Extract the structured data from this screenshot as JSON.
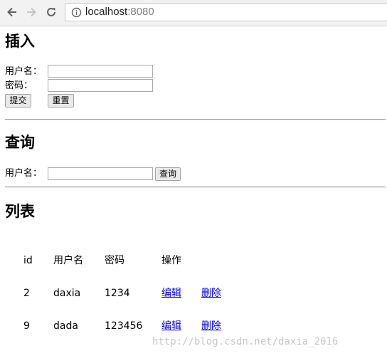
{
  "browser": {
    "url_host": "localhost",
    "url_port": ":8080"
  },
  "insert": {
    "heading": "插入",
    "username_label": "用户名：",
    "password_label": "密码：",
    "username_value": "",
    "password_value": "",
    "submit_label": "提交",
    "reset_label": "重置"
  },
  "query": {
    "heading": "查询",
    "username_label": "用户名：",
    "username_value": "",
    "query_label": "查询"
  },
  "list": {
    "heading": "列表",
    "headers": [
      "id",
      "用户名",
      "密码",
      "操作"
    ],
    "rows": [
      {
        "id": "2",
        "username": "daxia",
        "password": "1234",
        "edit": "编辑",
        "delete": "删除"
      },
      {
        "id": "9",
        "username": "dada",
        "password": "123456",
        "edit": "编辑",
        "delete": "删除"
      }
    ]
  },
  "watermark": "http://blog.csdn.net/daxia_2016"
}
